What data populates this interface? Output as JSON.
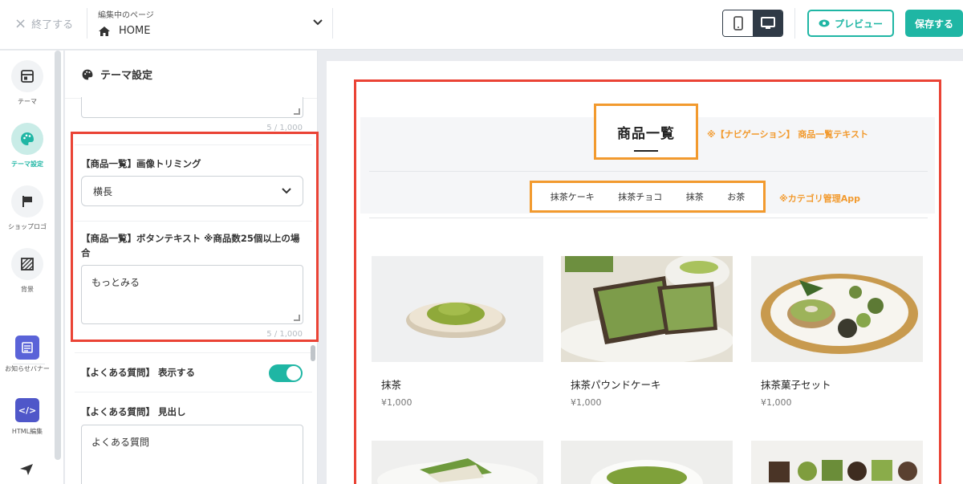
{
  "topbar": {
    "exit_label": "終了する",
    "page_caption": "編集中のページ",
    "page_name": "HOME",
    "preview_label": "プレビュー",
    "save_label": "保存する"
  },
  "rail": {
    "items": [
      {
        "label": "テーマ"
      },
      {
        "label": "テーマ設定"
      },
      {
        "label": "ショップロゴ"
      },
      {
        "label": "背景"
      },
      {
        "label": "お知らせバナー"
      },
      {
        "label": "HTML編集"
      }
    ]
  },
  "panel": {
    "title": "テーマ設定",
    "counter_top": "5 / 1,000",
    "trimming_label": "【商品一覧】画像トリミング",
    "trimming_value": "横長",
    "button_text_label": "【商品一覧】ボタンテキスト ※商品数25個以上の場合",
    "button_text_value": "もっとみる",
    "counter_button": "5 / 1,000",
    "faq_show_label": "【よくある質問】 表示する",
    "faq_show_on": true,
    "faq_heading_label": "【よくある質問】 見出し",
    "faq_heading_value": "よくある質問"
  },
  "preview": {
    "section_title": "商品一覧",
    "note_title": "※【ナビゲーション】 商品一覧テキスト",
    "categories": [
      "抹茶ケーキ",
      "抹茶チョコ",
      "抹茶",
      "お茶"
    ],
    "note_categories": "※カテゴリ管理App",
    "products": [
      {
        "name": "抹茶",
        "price": "¥1,000"
      },
      {
        "name": "抹茶パウンドケーキ",
        "price": "¥1,000"
      },
      {
        "name": "抹茶菓子セット",
        "price": "¥1,000"
      }
    ]
  },
  "colors": {
    "accent": "#1fb6a4",
    "highlight_red": "#ea4335",
    "highlight_orange": "#f29a2e",
    "dark": "#2f3a46"
  }
}
